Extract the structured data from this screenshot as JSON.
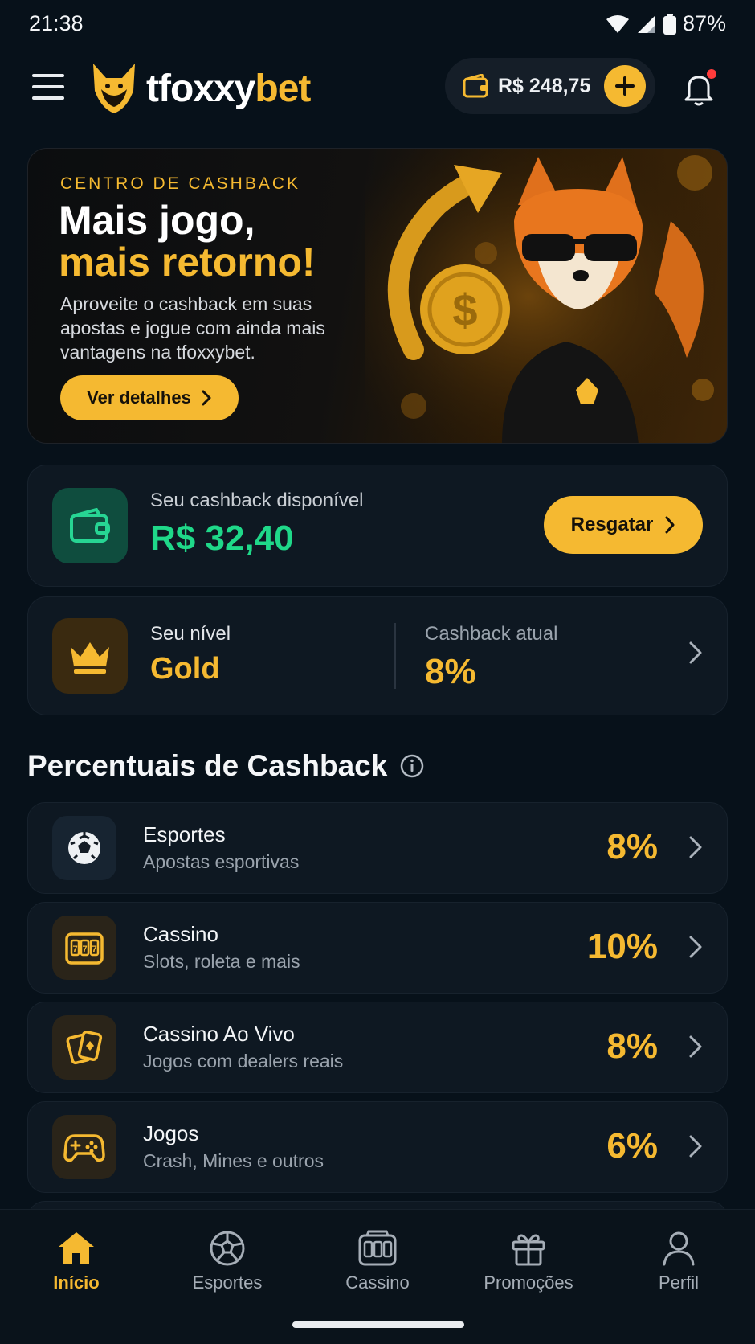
{
  "status_bar": {
    "time": "21:38",
    "battery": "87%"
  },
  "header": {
    "logo_white": "tfoxxy",
    "logo_yellow": "bet",
    "balance": "R$ 248,75"
  },
  "hero": {
    "eyebrow": "CENTRO DE CASHBACK",
    "title_line1": "Mais jogo,",
    "title_line2": "mais retorno!",
    "description": "Aproveite o cashback em suas apostas e jogue com ainda mais vantagens na tfoxxybet.",
    "button": "Ver detalhes"
  },
  "cashback": {
    "label": "Seu cashback disponível",
    "value": "R$ 32,40",
    "button": "Resgatar"
  },
  "level": {
    "label": "Seu nível",
    "value": "Gold",
    "cashback_label": "Cashback atual",
    "cashback_value": "8%"
  },
  "section": {
    "title": "Percentuais de Cashback"
  },
  "categories": [
    {
      "title": "Esportes",
      "subtitle": "Apostas esportivas",
      "percent": "8%",
      "icon": "soccer-ball-icon"
    },
    {
      "title": "Cassino",
      "subtitle": "Slots, roleta e mais",
      "percent": "10%",
      "icon": "slot-machine-icon"
    },
    {
      "title": "Cassino Ao Vivo",
      "subtitle": "Jogos com dealers reais",
      "percent": "8%",
      "icon": "playing-cards-icon"
    },
    {
      "title": "Jogos",
      "subtitle": "Crash, Mines e outros",
      "percent": "6%",
      "icon": "gamepad-icon"
    }
  ],
  "bottom_nav": [
    {
      "label": "Início",
      "active": true
    },
    {
      "label": "Esportes"
    },
    {
      "label": "Cassino"
    },
    {
      "label": "Promoções"
    },
    {
      "label": "Perfil"
    }
  ],
  "colors": {
    "accent": "#f5b931",
    "cashback_green": "#1fd889",
    "background": "#07111a",
    "card": "#0e1822"
  }
}
